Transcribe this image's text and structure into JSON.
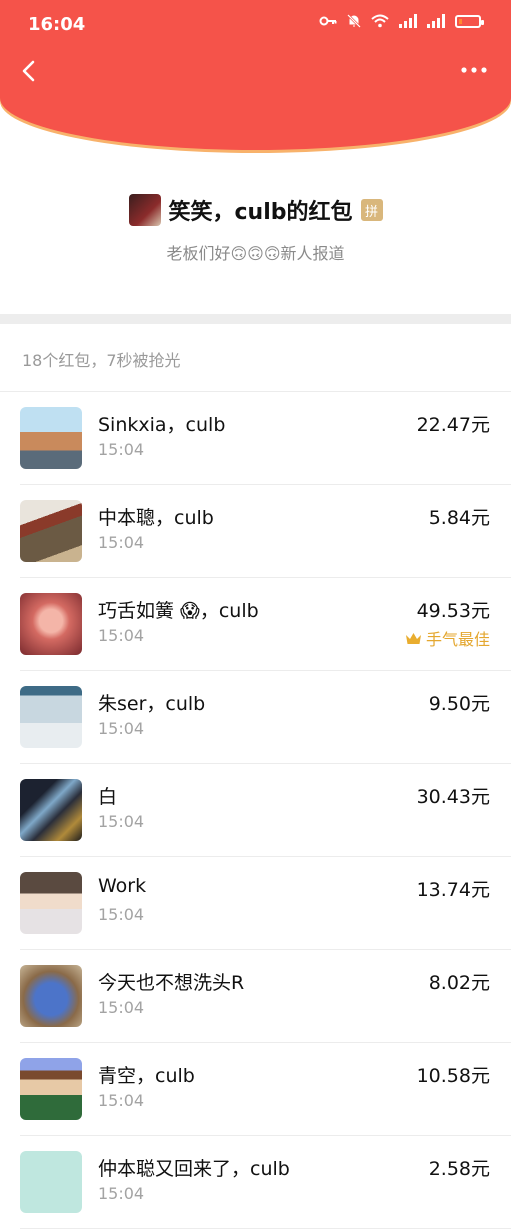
{
  "status_bar": {
    "time": "16:04"
  },
  "header": {
    "accent_color": "#f5534a"
  },
  "packet": {
    "title": "笑笑，culb的红包",
    "pin_badge": "拼",
    "blessing": "老板们好🙃🙃🙃新人报道"
  },
  "summary": "18个红包，7秒被抢光",
  "recipients": [
    {
      "name": "Sinkxia，culb",
      "time": "15:04",
      "amount": "22.47元",
      "best": ""
    },
    {
      "name": "中本聰，culb",
      "time": "15:04",
      "amount": "5.84元",
      "best": ""
    },
    {
      "name": "巧舌如簧 😱，culb",
      "time": "15:04",
      "amount": "49.53元",
      "best": "手气最佳"
    },
    {
      "name": "朱ser，culb",
      "time": "15:04",
      "amount": "9.50元",
      "best": ""
    },
    {
      "name": "白",
      "time": "15:04",
      "amount": "30.43元",
      "best": ""
    },
    {
      "name": "Work",
      "time": "15:04",
      "amount": "13.74元",
      "best": ""
    },
    {
      "name": "今天也不想洗头R",
      "time": "15:04",
      "amount": "8.02元",
      "best": ""
    },
    {
      "name": "青空，culb",
      "time": "15:04",
      "amount": "10.58元",
      "best": ""
    },
    {
      "name": "仲本聪又回来了，culb",
      "time": "15:04",
      "amount": "2.58元",
      "best": ""
    }
  ]
}
